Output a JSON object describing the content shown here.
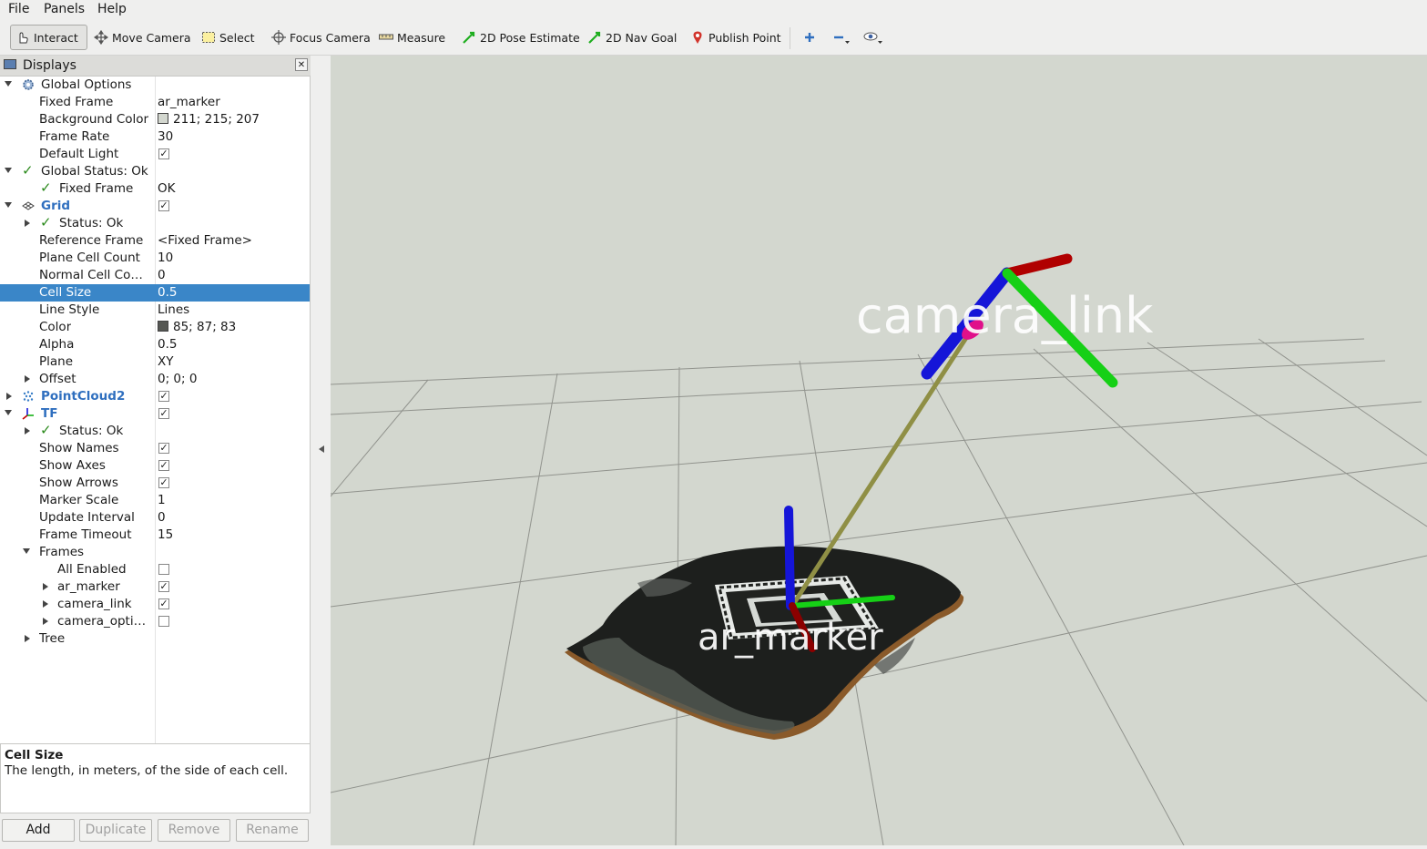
{
  "menu": [
    "File",
    "Panels",
    "Help"
  ],
  "toolbar": {
    "tools": [
      "Interact",
      "Move Camera",
      "Select",
      "Focus Camera",
      "Measure",
      "2D Pose Estimate",
      "2D Nav Goal",
      "Publish Point"
    ],
    "active": "Interact"
  },
  "panel": {
    "title": "Displays",
    "rows": [
      {
        "name": "Global Options",
        "value": ""
      },
      {
        "name": "Fixed Frame",
        "value": "ar_marker"
      },
      {
        "name": "Background Color",
        "value": "211; 215; 207"
      },
      {
        "name": "Frame Rate",
        "value": "30"
      },
      {
        "name": "Default Light",
        "value": ""
      },
      {
        "name": "Global Status: Ok",
        "value": ""
      },
      {
        "name": "Fixed Frame",
        "value": "OK"
      },
      {
        "name": "Grid",
        "value": ""
      },
      {
        "name": "Status: Ok",
        "value": ""
      },
      {
        "name": "Reference Frame",
        "value": "<Fixed Frame>"
      },
      {
        "name": "Plane Cell Count",
        "value": "10"
      },
      {
        "name": "Normal Cell Co…",
        "value": "0"
      },
      {
        "name": "Cell Size",
        "value": "0.5"
      },
      {
        "name": "Line Style",
        "value": "Lines"
      },
      {
        "name": "Color",
        "value": "85; 87; 83"
      },
      {
        "name": "Alpha",
        "value": "0.5"
      },
      {
        "name": "Plane",
        "value": "XY"
      },
      {
        "name": "Offset",
        "value": "0; 0; 0"
      },
      {
        "name": "PointCloud2",
        "value": ""
      },
      {
        "name": "TF",
        "value": ""
      },
      {
        "name": "Status: Ok",
        "value": ""
      },
      {
        "name": "Show Names",
        "value": ""
      },
      {
        "name": "Show Axes",
        "value": ""
      },
      {
        "name": "Show Arrows",
        "value": ""
      },
      {
        "name": "Marker Scale",
        "value": "1"
      },
      {
        "name": "Update Interval",
        "value": "0"
      },
      {
        "name": "Frame Timeout",
        "value": "15"
      },
      {
        "name": "Frames",
        "value": ""
      },
      {
        "name": "All Enabled",
        "value": ""
      },
      {
        "name": "ar_marker",
        "value": ""
      },
      {
        "name": "camera_link",
        "value": ""
      },
      {
        "name": "camera_opti…",
        "value": ""
      },
      {
        "name": "Tree",
        "value": ""
      }
    ],
    "checkboxes": {
      "default_light": true,
      "grid": true,
      "pointcloud2": true,
      "tf": true,
      "show_names": true,
      "show_axes": true,
      "show_arrows": true,
      "all_enabled": false,
      "ar_marker": true,
      "camera_link": true,
      "camera_optical": false
    },
    "selected_row": "Cell Size",
    "colors": {
      "background_color": "#d3d7cf",
      "grid_color": "#555753",
      "selection": "#3a86c8"
    }
  },
  "description": {
    "title": "Cell Size",
    "text": "The length, in meters, of the side of each cell."
  },
  "buttons": {
    "add": "Add",
    "duplicate": "Duplicate",
    "remove": "Remove",
    "rename": "Rename"
  },
  "viewport": {
    "frame_labels": {
      "camera": "camera_link",
      "marker": "ar_marker"
    },
    "axis_colors": {
      "x": "#b00000",
      "y": "#16d016",
      "z": "#1515d8",
      "link": "#9a9a4a"
    }
  }
}
